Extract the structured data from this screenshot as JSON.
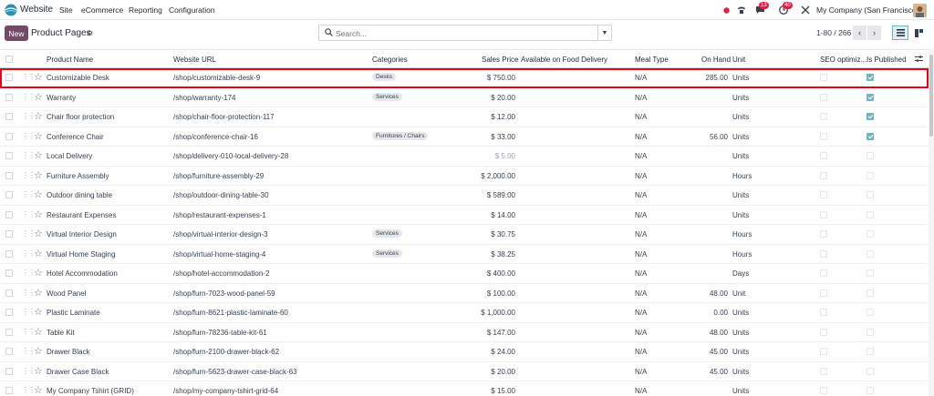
{
  "nav": {
    "app_name": "Website",
    "menu": [
      "Site",
      "eCommerce",
      "Reporting",
      "Configuration"
    ],
    "chat_badge": "13",
    "activity_badge": "40",
    "company": "My Company (San Francisco)"
  },
  "control": {
    "new_label": "New",
    "title": "Product Pages",
    "search_placeholder": "Search...",
    "pager": "1-80 / 266"
  },
  "columns": [
    "Product Name",
    "Website URL",
    "Categories",
    "Sales Price",
    "Available on Food Delivery",
    "Meal Type",
    "On Hand",
    "Unit",
    "SEO optimiz...",
    "Is Published"
  ],
  "rows": [
    {
      "name": "Customizable Desk",
      "url": "/shop/customizable-desk-9",
      "category": "Desks",
      "price": "$ 750.00",
      "meal": "N/A",
      "onhand": "285.00",
      "unit": "Units",
      "published": true,
      "selected": true
    },
    {
      "name": "Warranty",
      "url": "/shop/warranty-174",
      "category": "Services",
      "price": "$ 20.00",
      "meal": "N/A",
      "onhand": "",
      "unit": "Units",
      "published": true
    },
    {
      "name": "Chair floor protection",
      "url": "/shop/chair-floor-protection-117",
      "category": "",
      "price": "$ 12.00",
      "meal": "N/A",
      "onhand": "",
      "unit": "Units",
      "published": true
    },
    {
      "name": "Conference Chair",
      "url": "/shop/conference-chair-16",
      "category": "Furnitures / Chairs",
      "price": "$ 33.00",
      "meal": "N/A",
      "onhand": "56.00",
      "unit": "Units",
      "published": true
    },
    {
      "name": "Local Delivery",
      "url": "/shop/delivery-010-local-delivery-28",
      "category": "",
      "price": "$ 5.00",
      "price_muted": true,
      "meal": "N/A",
      "onhand": "",
      "unit": "Units",
      "published": false
    },
    {
      "name": "Furniture Assembly",
      "url": "/shop/furniture-assembly-29",
      "category": "",
      "price": "$ 2,000.00",
      "meal": "N/A",
      "onhand": "",
      "unit": "Hours",
      "published": false
    },
    {
      "name": "Outdoor dining table",
      "url": "/shop/outdoor-dining-table-30",
      "category": "",
      "price": "$ 589.00",
      "meal": "N/A",
      "onhand": "",
      "unit": "Units",
      "published": false
    },
    {
      "name": "Restaurant Expenses",
      "url": "/shop/restaurant-expenses-1",
      "category": "",
      "price": "$ 14.00",
      "meal": "N/A",
      "onhand": "",
      "unit": "Units",
      "published": false
    },
    {
      "name": "Virtual Interior Design",
      "url": "/shop/virtual-interior-design-3",
      "category": "Services",
      "price": "$ 30.75",
      "meal": "N/A",
      "onhand": "",
      "unit": "Hours",
      "published": false
    },
    {
      "name": "Virtual Home Staging",
      "url": "/shop/virtual-home-staging-4",
      "category": "Services",
      "price": "$ 38.25",
      "meal": "N/A",
      "onhand": "",
      "unit": "Hours",
      "published": false
    },
    {
      "name": "Hotel Accommodation",
      "url": "/shop/hotel-accommodation-2",
      "category": "",
      "price": "$ 400.00",
      "meal": "N/A",
      "onhand": "",
      "unit": "Days",
      "published": false
    },
    {
      "name": "Wood Panel",
      "url": "/shop/furn-7023-wood-panel-59",
      "category": "",
      "price": "$ 100.00",
      "meal": "N/A",
      "onhand": "48.00",
      "unit": "Unit",
      "published": false
    },
    {
      "name": "Plastic Laminate",
      "url": "/shop/furn-8621-plastic-laminate-60",
      "category": "",
      "price": "$ 1,000.00",
      "meal": "N/A",
      "onhand": "0.00",
      "unit": "Units",
      "published": false
    },
    {
      "name": "Table Kit",
      "url": "/shop/furn-78236-table-kit-61",
      "category": "",
      "price": "$ 147.00",
      "meal": "N/A",
      "onhand": "48.00",
      "unit": "Units",
      "published": false
    },
    {
      "name": "Drawer Black",
      "url": "/shop/furn-2100-drawer-black-62",
      "category": "",
      "price": "$ 24.00",
      "meal": "N/A",
      "onhand": "45.00",
      "unit": "Units",
      "published": false
    },
    {
      "name": "Drawer Case Black",
      "url": "/shop/furn-5623-drawer-case-black-63",
      "category": "",
      "price": "$ 20.00",
      "meal": "N/A",
      "onhand": "45.00",
      "unit": "Units",
      "published": false
    },
    {
      "name": "My Company Tshirt (GRID)",
      "url": "/shop/my-company-tshirt-grid-64",
      "category": "",
      "price": "$ 15.00",
      "meal": "N/A",
      "onhand": "",
      "unit": "Units",
      "published": false
    }
  ]
}
